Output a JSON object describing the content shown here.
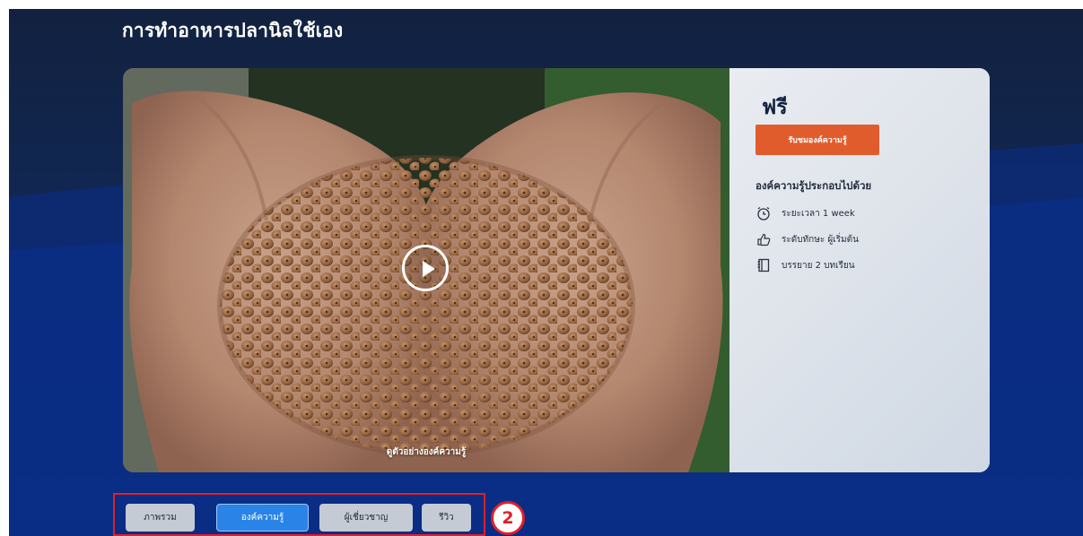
{
  "course": {
    "title": "การทำอาหารปลานิลใช้เอง"
  },
  "media": {
    "preview_label": "ดูตัวอย่างองค์ความรู้"
  },
  "sidebar": {
    "price": "ฟรี",
    "enroll_label": "รับชมองค์ความรู้",
    "includes_title": "องค์ความรู้ประกอบไปด้วย",
    "items": [
      {
        "icon": "alarm-clock-icon",
        "text": "ระยะเวลา 1 week"
      },
      {
        "icon": "thumbs-up-icon",
        "text": "ระดับทักษะ ผู้เริ่มต้น"
      },
      {
        "icon": "notebook-icon",
        "text": "บรรยาย 2 บทเรียน"
      }
    ]
  },
  "tabs": [
    {
      "label": "ภาพรวม",
      "active": false
    },
    {
      "label": "องค์ความรู้",
      "active": true
    },
    {
      "label": "ผู้เชี่ยวชาญ",
      "active": false
    },
    {
      "label": "รีวิว",
      "active": false
    }
  ],
  "annotation": {
    "step_number": "2",
    "color": "#e0202a"
  },
  "colors": {
    "background": "#12213f",
    "accent_orange": "#e15c2c",
    "active_tab": "#2a83e6"
  }
}
